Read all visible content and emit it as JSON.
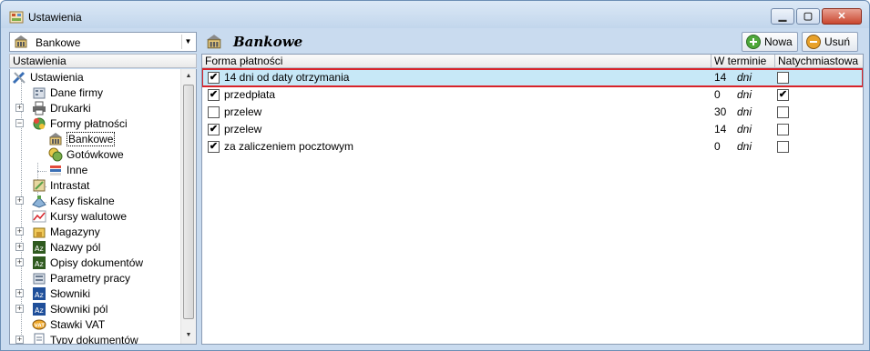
{
  "window": {
    "title": "Ustawienia"
  },
  "left": {
    "combo_value": "Bankowe",
    "tree_header": "Ustawienia",
    "tree": [
      {
        "label": "Ustawienia",
        "icon": "tools-icon"
      },
      {
        "label": "Dane firmy",
        "icon": "company-icon"
      },
      {
        "label": "Drukarki",
        "icon": "printer-icon"
      },
      {
        "label": "Formy płatności",
        "icon": "payment-icon"
      },
      {
        "label": "Bankowe",
        "icon": "bank-icon"
      },
      {
        "label": "Gotówkowe",
        "icon": "cash-icon"
      },
      {
        "label": "Inne",
        "icon": "other-icon"
      },
      {
        "label": "Intrastat",
        "icon": "intrastat-icon"
      },
      {
        "label": "Kasy fiskalne",
        "icon": "cash-register-icon"
      },
      {
        "label": "Kursy walutowe",
        "icon": "chart-icon"
      },
      {
        "label": "Magazyny",
        "icon": "warehouse-icon"
      },
      {
        "label": "Nazwy pól",
        "icon": "az-icon"
      },
      {
        "label": "Opisy dokumentów",
        "icon": "az-icon"
      },
      {
        "label": "Parametry pracy",
        "icon": "params-icon"
      },
      {
        "label": "Słowniki",
        "icon": "az-blue-icon"
      },
      {
        "label": "Słowniki pól",
        "icon": "az-blue-icon"
      },
      {
        "label": "Stawki VAT",
        "icon": "vat-icon"
      },
      {
        "label": "Typy dokumentów",
        "icon": "doc-icon"
      }
    ]
  },
  "right": {
    "title": "Bankowe",
    "new_button": "Nowa",
    "delete_button": "Usuń",
    "columns": [
      "Forma płatności",
      "W terminie",
      "Natychmiastowa"
    ],
    "rows": [
      {
        "checked": true,
        "name": "14 dni od daty otrzymania",
        "days": "14",
        "unit": "dni",
        "immediate": false,
        "selected": true
      },
      {
        "checked": true,
        "name": "przedpłata",
        "days": "0",
        "unit": "dni",
        "immediate": true,
        "selected": false
      },
      {
        "checked": false,
        "name": "przelew",
        "days": "30",
        "unit": "dni",
        "immediate": false,
        "selected": false
      },
      {
        "checked": true,
        "name": "przelew",
        "days": "14",
        "unit": "dni",
        "immediate": false,
        "selected": false
      },
      {
        "checked": true,
        "name": "za zaliczeniem pocztowym",
        "days": "0",
        "unit": "dni",
        "immediate": false,
        "selected": false
      }
    ]
  },
  "colors": {
    "selection": "#c7e8f7",
    "highlight_border": "#d8232a",
    "window_frame": "#c9dbef"
  }
}
